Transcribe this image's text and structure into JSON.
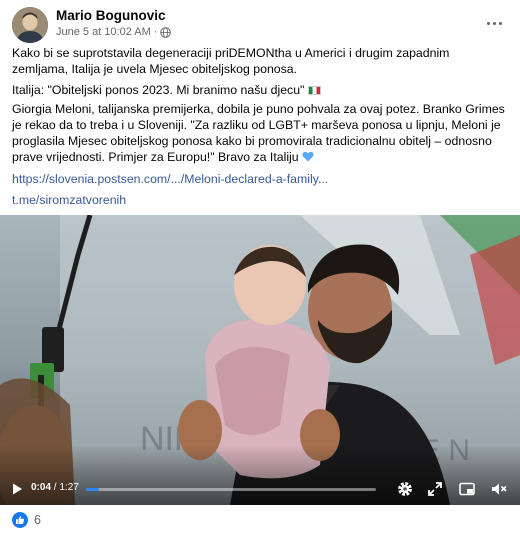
{
  "post": {
    "author": "Mario Bogunovic",
    "timestamp": "June 5 at 10:02 AM",
    "separator": "·",
    "audience_icon": "globe-icon",
    "paragraph1": "Kako bi se suprotstavila degeneraciji priDEMONtha u Americi i drugim zapadnim zemljama, Italija je uvela Mjesec obiteljskog ponosa.",
    "paragraph2": "Italija: \"Obiteljski ponos 2023. Mi branimo našu djecu\"",
    "paragraph3": "Giorgia Meloni, talijanska premijerka, dobila je puno pohvala za ovaj potez. Branko Grimes je rekao da to treba i u Sloveniji. \"Za razliku od LGBT+ marševa ponosa u lipnju, Meloni je proglasila Mjesec obiteljskog ponosa kako bi promovirala tradicionalnu obitelj – odnosno prave vrijednosti. Primjer za Europu!\" Bravo za Italiju",
    "link1": "https://slovenia.postsen.com/.../Meloni-declared-a-family...",
    "link2": "t.me/siromzatvorenih"
  },
  "video": {
    "current_time": "0:04",
    "time_separator": " / ",
    "duration": "1:27",
    "progress_fraction": 0.046,
    "controls": [
      "play-icon",
      "settings-icon",
      "expand-icon",
      "picture-in-picture-icon",
      "volume-muted-icon"
    ]
  },
  "reactions": {
    "count": "6",
    "icon": "like-icon"
  },
  "colors": {
    "link": "#385898",
    "muted": "#65676b",
    "accent": "#1877f2",
    "progress": "#2d88ff"
  }
}
